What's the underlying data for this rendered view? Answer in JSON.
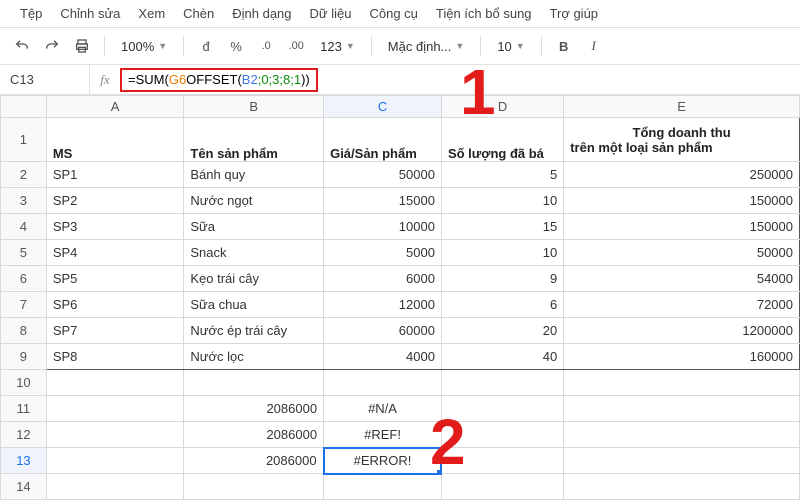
{
  "menu": {
    "items": [
      "Tệp",
      "Chỉnh sửa",
      "Xem",
      "Chèn",
      "Định dạng",
      "Dữ liệu",
      "Công cụ",
      "Tiện ích bổ sung",
      "Trợ giúp"
    ]
  },
  "toolbar": {
    "zoom": "100%",
    "currency": "đ",
    "percent": "%",
    "dec_less": ".0",
    "dec_more": ".00",
    "numfmt": "123",
    "font": "Mặc định...",
    "fontsize": "10",
    "bold": "B",
    "italic": "I"
  },
  "namebox": "C13",
  "formula": {
    "raw": "=SUM(G6 OFFSET(B2;0;3;8;1))",
    "p_eq": "=",
    "p_fn": "SUM",
    "p_op": "(",
    "p_ref1": "G6",
    "p_sp": " ",
    "p_fn2": "OFFSET",
    "p_op2": "(",
    "p_ref2": "B2",
    "p_args": ";0;3;8;1",
    "p_cl": "))"
  },
  "columns": [
    "A",
    "B",
    "C",
    "D",
    "E"
  ],
  "headers": {
    "ms": "MS",
    "ten": "Tên sản phẩm",
    "gia": "Giá/Sản phẩm",
    "sl": "Số lượng đã bá",
    "tong_l1": "Tổng doanh thu",
    "tong_l2": "trên một loại sản phẩm"
  },
  "rows": [
    {
      "r": "2",
      "ms": "SP1",
      "ten": "Bánh quy",
      "gia": "50000",
      "sl": "5",
      "tong": "250000"
    },
    {
      "r": "3",
      "ms": "SP2",
      "ten": "Nước ngọt",
      "gia": "15000",
      "sl": "10",
      "tong": "150000"
    },
    {
      "r": "4",
      "ms": "SP3",
      "ten": "Sữa",
      "gia": "10000",
      "sl": "15",
      "tong": "150000"
    },
    {
      "r": "5",
      "ms": "SP4",
      "ten": "Snack",
      "gia": "5000",
      "sl": "10",
      "tong": "50000"
    },
    {
      "r": "6",
      "ms": "SP5",
      "ten": "Kẹo trái cây",
      "gia": "6000",
      "sl": "9",
      "tong": "54000"
    },
    {
      "r": "7",
      "ms": "SP6",
      "ten": "Sữa chua",
      "gia": "12000",
      "sl": "6",
      "tong": "72000"
    },
    {
      "r": "8",
      "ms": "SP7",
      "ten": "Nước ép trái cây",
      "gia": "60000",
      "sl": "20",
      "tong": "1200000"
    },
    {
      "r": "9",
      "ms": "SP8",
      "ten": "Nước lọc",
      "gia": "4000",
      "sl": "40",
      "tong": "160000"
    }
  ],
  "summary": [
    {
      "r": "11",
      "b": "2086000",
      "c": "#N/A"
    },
    {
      "r": "12",
      "b": "2086000",
      "c": "#REF!"
    },
    {
      "r": "13",
      "b": "2086000",
      "c": "#ERROR!"
    }
  ],
  "callouts": {
    "one": "1",
    "two": "2"
  }
}
